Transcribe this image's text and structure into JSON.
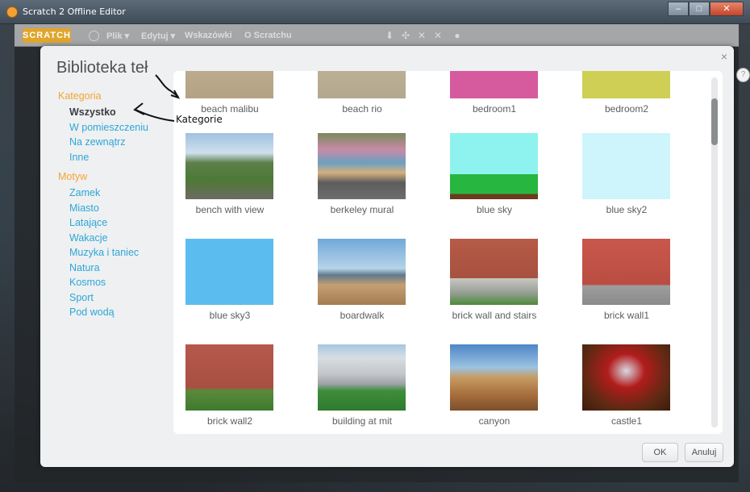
{
  "window": {
    "title": "Scratch 2 Offline Editor",
    "minimize": "–",
    "maximize": "□",
    "close": "✕"
  },
  "menubar": {
    "logo": "SCRATCH",
    "items": [
      "Plik ▾",
      "Edytuj ▾",
      "Wskazówki",
      "O Scratchu"
    ]
  },
  "library": {
    "title": "Biblioteka teł",
    "close": "×",
    "category_heading": "Kategoria",
    "categories": [
      "Wszystko",
      "W pomieszczeniu",
      "Na zewnątrz",
      "Inne"
    ],
    "theme_heading": "Motyw",
    "themes": [
      "Zamek",
      "Miasto",
      "Latające",
      "Wakacje",
      "Muzyka i taniec",
      "Natura",
      "Kosmos",
      "Sport",
      "Pod wodą"
    ],
    "backdrops": [
      "beach malibu",
      "beach rio",
      "bedroom1",
      "bedroom2",
      "bench with view",
      "berkeley mural",
      "blue sky",
      "blue sky2",
      "blue sky3",
      "boardwalk",
      "brick wall and stairs",
      "brick wall1",
      "brick wall2",
      "building at mit",
      "canyon",
      "castle1"
    ],
    "ok_label": "OK",
    "cancel_label": "Anuluj"
  },
  "annotation": {
    "label": "Kategorie"
  },
  "help_icon": "?"
}
